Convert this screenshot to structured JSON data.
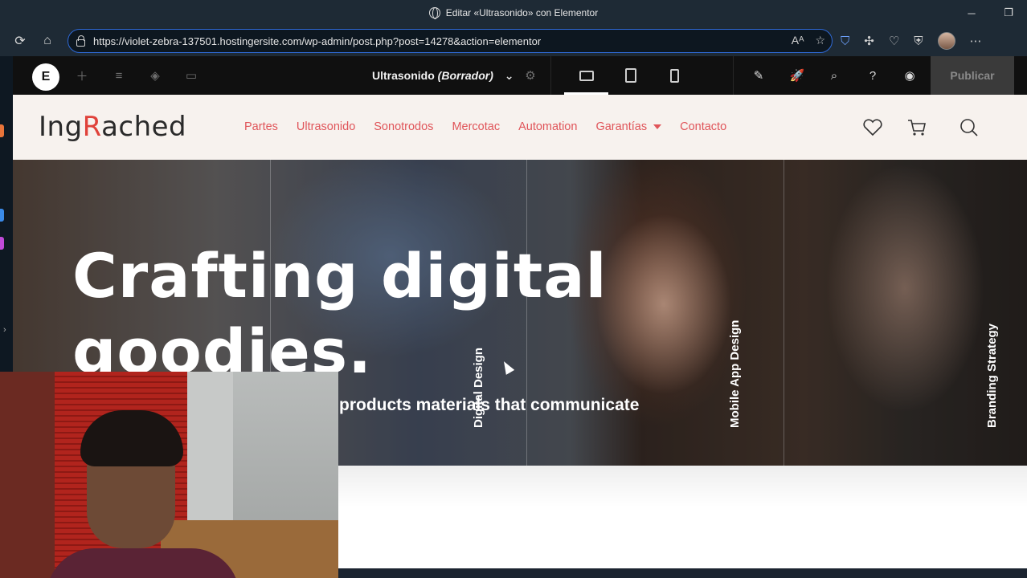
{
  "browser": {
    "window_title": "Editar «Ultrasonido» con Elementor",
    "url": "https://violet-zebra-137501.hostingersite.com/wp-admin/post.php?post=14278&action=elementor"
  },
  "elementor": {
    "logo_letter": "E",
    "doc_title": "Ultrasonido",
    "doc_status": "(Borrador)",
    "publish_label": "Publicar"
  },
  "site": {
    "logo_prefix": "Ing",
    "logo_accent": "R",
    "logo_suffix": "ached",
    "logo_accent_color": "#e0423a",
    "menu": [
      {
        "label": "Partes"
      },
      {
        "label": "Ultrasonido"
      },
      {
        "label": "Sonotrodos"
      },
      {
        "label": "Mercotac"
      },
      {
        "label": "Automation"
      },
      {
        "label": "Garantías"
      },
      {
        "label": "Contacto"
      }
    ],
    "menu_color": "#e0555a"
  },
  "hero": {
    "headline_line1": "Crafting digital",
    "headline_line2": "goodies.",
    "subline": "products materials that communicate",
    "vertical_labels": [
      "Digital Design",
      "Mobile App Design",
      "Branding Strategy"
    ]
  }
}
